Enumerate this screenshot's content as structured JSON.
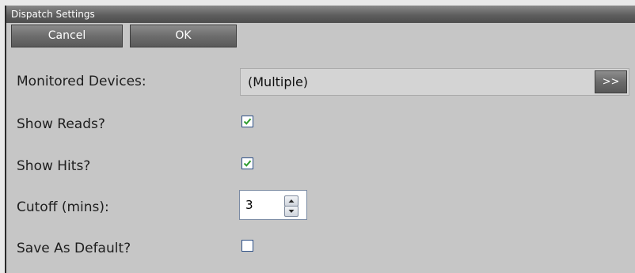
{
  "window": {
    "title": "Dispatch Settings"
  },
  "toolbar": {
    "cancel_label": "Cancel",
    "ok_label": "OK"
  },
  "form": {
    "monitored_devices": {
      "label": "Monitored Devices:",
      "value": "(Multiple)",
      "button_label": ">>"
    },
    "show_reads": {
      "label": "Show Reads?",
      "checked": true
    },
    "show_hits": {
      "label": "Show Hits?",
      "checked": true
    },
    "cutoff": {
      "label": "Cutoff (mins):",
      "value": "3"
    },
    "save_as_default": {
      "label": "Save As Default?",
      "checked": false
    }
  },
  "colors": {
    "checkmark": "#2e9c2e",
    "checkbox_border": "#2d4f86",
    "panel_background": "#c6c6c6"
  },
  "icons": {
    "checkbox_check": "checkmark-icon",
    "spin_up": "arrow-up-icon",
    "spin_down": "arrow-down-icon"
  }
}
